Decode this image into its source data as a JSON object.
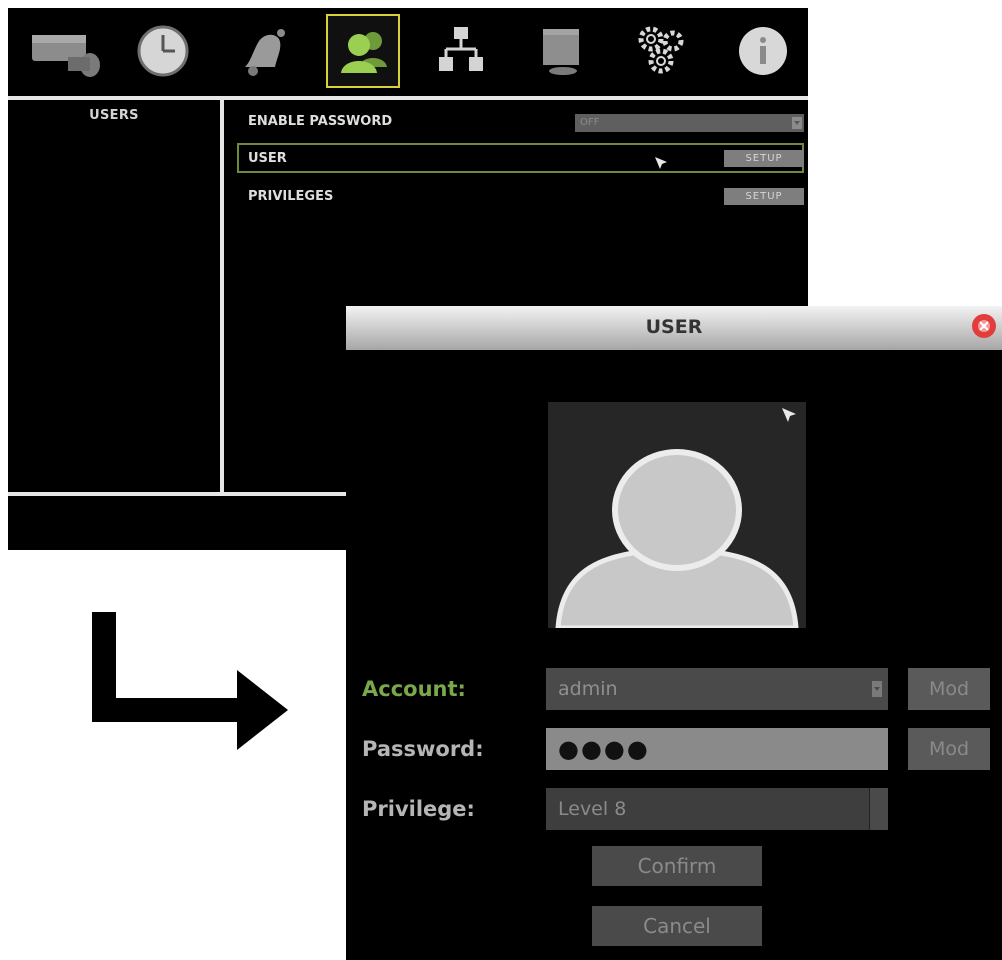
{
  "toolbar": {
    "icons": [
      "camera-icon",
      "clock-icon",
      "bell-icon",
      "users-icon",
      "network-icon",
      "monitor-icon",
      "gears-icon",
      "info-icon"
    ],
    "active": "users-icon",
    "active_color": "#d7d23a"
  },
  "left_panel": {
    "heading": "USERS"
  },
  "settings": {
    "enable_password_label": "ENABLE PASSWORD",
    "enable_password_value": "OFF",
    "user_label": "USER",
    "user_button": "SETUP",
    "privileges_label": "PRIVILEGES",
    "privileges_button": "SETUP"
  },
  "dialog": {
    "title": "USER",
    "account_label": "Account:",
    "account_value": "admin",
    "account_mod": "Mod",
    "password_label": "Password:",
    "password_value": "●●●●",
    "password_mod": "Mod",
    "privilege_label": "Privilege:",
    "privilege_value": "Level 8",
    "confirm": "Confirm",
    "cancel": "Cancel"
  },
  "colors": {
    "account_label": "#7aa84a",
    "highlight_border": "#6e8a3a",
    "close_button": "#e23c3c"
  }
}
